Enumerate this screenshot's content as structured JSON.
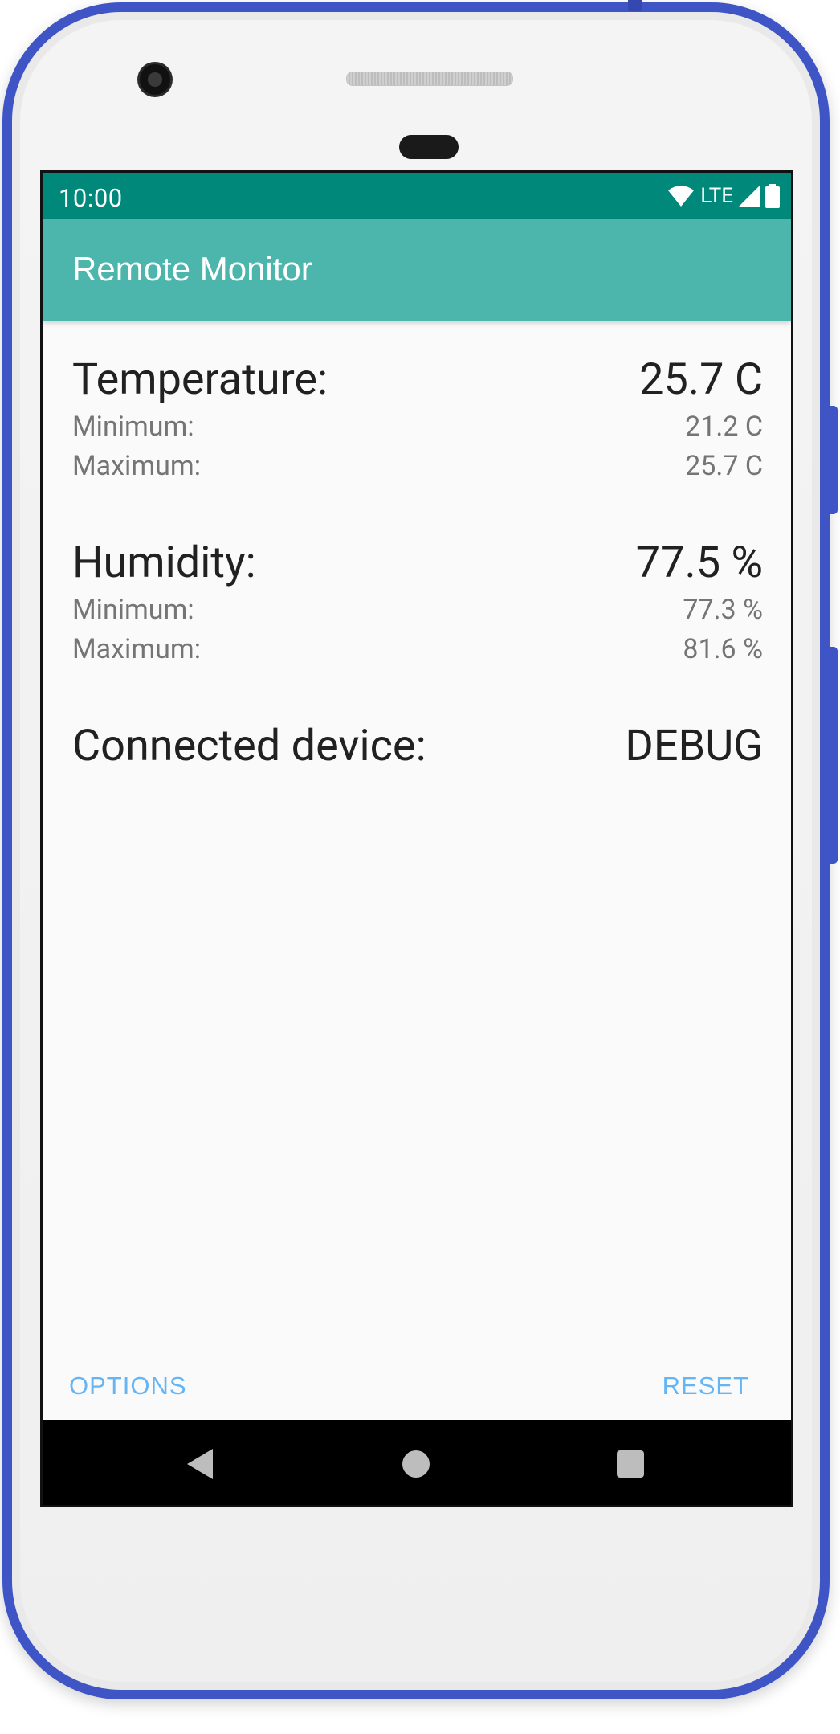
{
  "status_bar": {
    "time": "10:00",
    "network": "LTE",
    "icons": [
      "wifi-icon",
      "signal-icon",
      "battery-icon"
    ]
  },
  "app_bar": {
    "title": "Remote Monitor"
  },
  "temperature": {
    "label": "Temperature:",
    "value": "25.7 C",
    "min_label": "Minimum:",
    "min_value": "21.2 C",
    "max_label": "Maximum:",
    "max_value": "25.7 C"
  },
  "humidity": {
    "label": "Humidity:",
    "value": "77.5 %",
    "min_label": "Minimum:",
    "min_value": "77.3 %",
    "max_label": "Maximum:",
    "max_value": "81.6 %"
  },
  "device": {
    "label": "Connected device:",
    "value": "DEBUG"
  },
  "actions": {
    "options_label": "OPTIONS",
    "reset_label": "RESET"
  },
  "nav_bar": {
    "icons": [
      "back-icon",
      "home-icon",
      "recents-icon"
    ]
  },
  "colors": {
    "status_bar": "#00897b",
    "app_bar": "#4db6ac",
    "button_text": "#64b5f6",
    "phone_frame": "#3f55c6"
  }
}
